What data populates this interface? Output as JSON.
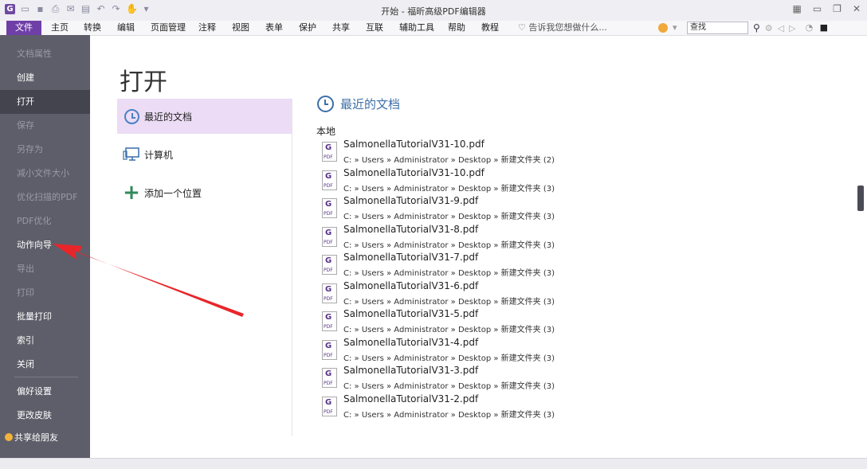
{
  "window": {
    "title": "开始 - 福昕高级PDF编辑器"
  },
  "ribbon": {
    "tabs": [
      "文件",
      "主页",
      "转换",
      "编辑",
      "页面管理",
      "注释",
      "视图",
      "表单",
      "保护",
      "共享",
      "互联",
      "辅助工具",
      "帮助",
      "教程"
    ],
    "tell_me": "告诉我您想做什么...",
    "search_value": "查找"
  },
  "sidebar": {
    "items": [
      {
        "label": "文档属性",
        "enabled": false
      },
      {
        "label": "创建",
        "enabled": true
      },
      {
        "label": "打开",
        "enabled": true,
        "active": true
      },
      {
        "label": "保存",
        "enabled": false
      },
      {
        "label": "另存为",
        "enabled": false
      },
      {
        "label": "减小文件大小",
        "enabled": false
      },
      {
        "label": "优化扫描的PDF",
        "enabled": false
      },
      {
        "label": "PDF优化",
        "enabled": false
      },
      {
        "label": "动作向导",
        "enabled": true
      },
      {
        "label": "导出",
        "enabled": false
      },
      {
        "label": "打印",
        "enabled": false
      },
      {
        "label": "批量打印",
        "enabled": true
      },
      {
        "label": "索引",
        "enabled": true
      },
      {
        "label": "关闭",
        "enabled": true
      },
      {
        "label": "偏好设置",
        "enabled": true
      },
      {
        "label": "更改皮肤",
        "enabled": true
      },
      {
        "label": "共享给朋友",
        "enabled": true
      }
    ]
  },
  "main": {
    "title": "打开",
    "locations": [
      {
        "label": "最近的文档",
        "icon": "clock-icon",
        "selected": true
      },
      {
        "label": "计算机",
        "icon": "computer-icon",
        "selected": false
      },
      {
        "label": "添加一个位置",
        "icon": "plus-icon",
        "selected": false
      }
    ],
    "recent_header": "最近的文档",
    "local_label": "本地",
    "files": [
      {
        "name": "SalmonellaTutorialV31-10.pdf",
        "path": "C: » Users » Administrator » Desktop » 新建文件夹 (2)"
      },
      {
        "name": "SalmonellaTutorialV31-10.pdf",
        "path": "C: » Users » Administrator » Desktop » 新建文件夹 (3)"
      },
      {
        "name": "SalmonellaTutorialV31-9.pdf",
        "path": "C: » Users » Administrator » Desktop » 新建文件夹 (3)"
      },
      {
        "name": "SalmonellaTutorialV31-8.pdf",
        "path": "C: » Users » Administrator » Desktop » 新建文件夹 (3)"
      },
      {
        "name": "SalmonellaTutorialV31-7.pdf",
        "path": "C: » Users » Administrator » Desktop » 新建文件夹 (3)"
      },
      {
        "name": "SalmonellaTutorialV31-6.pdf",
        "path": "C: » Users » Administrator » Desktop » 新建文件夹 (3)"
      },
      {
        "name": "SalmonellaTutorialV31-5.pdf",
        "path": "C: » Users » Administrator » Desktop » 新建文件夹 (3)"
      },
      {
        "name": "SalmonellaTutorialV31-4.pdf",
        "path": "C: » Users » Administrator » Desktop » 新建文件夹 (3)"
      },
      {
        "name": "SalmonellaTutorialV31-3.pdf",
        "path": "C: » Users » Administrator » Desktop » 新建文件夹 (3)"
      },
      {
        "name": "SalmonellaTutorialV31-2.pdf",
        "path": "C: » Users » Administrator » Desktop » 新建文件夹 (3)"
      }
    ]
  },
  "colors": {
    "accent": "#6f3fa8",
    "sidebar": "#5e5e6a",
    "selected": "#ecdcf5",
    "arrow": "#e8262a"
  }
}
